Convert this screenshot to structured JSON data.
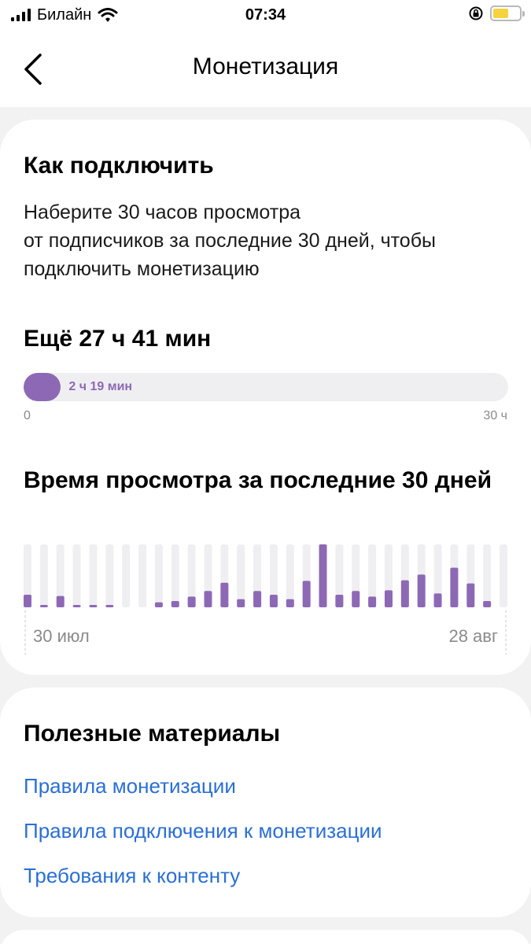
{
  "status_bar": {
    "carrier": "Билайн",
    "time": "07:34",
    "battery_level": 0.58
  },
  "nav": {
    "title": "Монетизация",
    "back_icon": "chevron-left-icon"
  },
  "connect": {
    "title": "Как подключить",
    "description": "Наберите 30 часов просмотра\nот подписчиков за последние 30 дней, чтобы\nподключить монетизацию",
    "remaining": "Ещё 27 ч 41 мин",
    "progress": {
      "value_label": "2 ч 19 мин",
      "fraction": 0.077,
      "min_label": "0",
      "max_label": "30 ч"
    }
  },
  "watch_time": {
    "title": "Время просмотра за последние 30 дней",
    "x_start_label": "30 июл",
    "x_end_label": "28 авг"
  },
  "chart_data": {
    "type": "bar",
    "title": "Время просмотра за последние 30 дней",
    "x_start": "30 июл",
    "x_end": "28 авг",
    "values": [
      0.2,
      0.03,
      0.18,
      0.03,
      0.03,
      0.03,
      0,
      0,
      0.08,
      0.1,
      0.17,
      0.26,
      0.39,
      0.13,
      0.26,
      0.2,
      0.13,
      0.42,
      1.0,
      0.2,
      0.26,
      0.17,
      0.27,
      0.43,
      0.52,
      0.22,
      0.63,
      0.38,
      0.1,
      0
    ],
    "bar_color": "#8d69b5",
    "track_color": "#efeff1"
  },
  "materials": {
    "title": "Полезные материалы",
    "links": [
      "Правила монетизации",
      "Правила подключения к монетизации",
      "Требования к контенту"
    ]
  },
  "colors": {
    "accent": "#8d69b5",
    "link": "#2a6fd6",
    "background": "#f2f2f2"
  }
}
